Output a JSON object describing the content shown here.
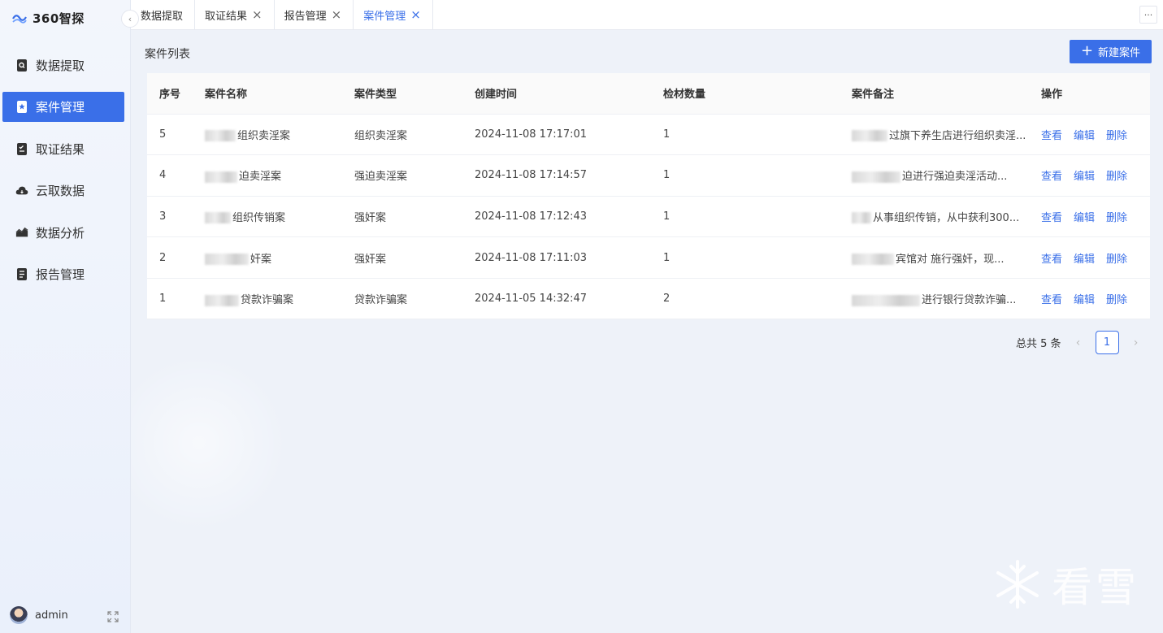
{
  "app": {
    "logo_text": "360智探",
    "user_name": "admin"
  },
  "sidebar": {
    "items": [
      {
        "label": "数据提取",
        "icon": "search-doc-icon"
      },
      {
        "label": "案件管理",
        "icon": "star-doc-icon"
      },
      {
        "label": "取证结果",
        "icon": "checklist-icon"
      },
      {
        "label": "云取数据",
        "icon": "cloud-icon"
      },
      {
        "label": "数据分析",
        "icon": "chart-icon"
      },
      {
        "label": "报告管理",
        "icon": "report-icon"
      }
    ]
  },
  "tabs": [
    {
      "label": "数据提取",
      "closable": false
    },
    {
      "label": "取证结果",
      "closable": true
    },
    {
      "label": "报告管理",
      "closable": true
    },
    {
      "label": "案件管理",
      "closable": true
    }
  ],
  "page": {
    "title": "案件列表",
    "new_button": "新建案件"
  },
  "table": {
    "headers": [
      "序号",
      "案件名称",
      "案件类型",
      "创建时间",
      "检材数量",
      "案件备注",
      "操作"
    ],
    "rows": [
      {
        "no": "5",
        "name": "组织卖淫案",
        "type": "组织卖淫案",
        "time": "2024-11-08 17:17:01",
        "count": "1",
        "remark": "过旗下养生店进行组织卖淫..."
      },
      {
        "no": "4",
        "name": "迫卖淫案",
        "type": "强迫卖淫案",
        "time": "2024-11-08 17:14:57",
        "count": "1",
        "remark": "迫进行强迫卖淫活动..."
      },
      {
        "no": "3",
        "name": "组织传销案",
        "type": "强奸案",
        "time": "2024-11-08 17:12:43",
        "count": "1",
        "remark": "从事组织传销，从中获利300..."
      },
      {
        "no": "2",
        "name": "奸案",
        "type": "强奸案",
        "time": "2024-11-08 17:11:03",
        "count": "1",
        "remark": "宾馆对 施行强奸，现..."
      },
      {
        "no": "1",
        "name": "贷款诈骗案",
        "type": "贷款诈骗案",
        "time": "2024-11-05 14:32:47",
        "count": "2",
        "remark": "进行银行贷款诈骗..."
      }
    ],
    "actions": [
      "查看",
      "编辑",
      "删除"
    ]
  },
  "pagination": {
    "total_text": "总共 5 条",
    "current_page": "1"
  },
  "watermark": {
    "text": "看雪"
  },
  "colors": {
    "primary": "#3a6fe8"
  }
}
